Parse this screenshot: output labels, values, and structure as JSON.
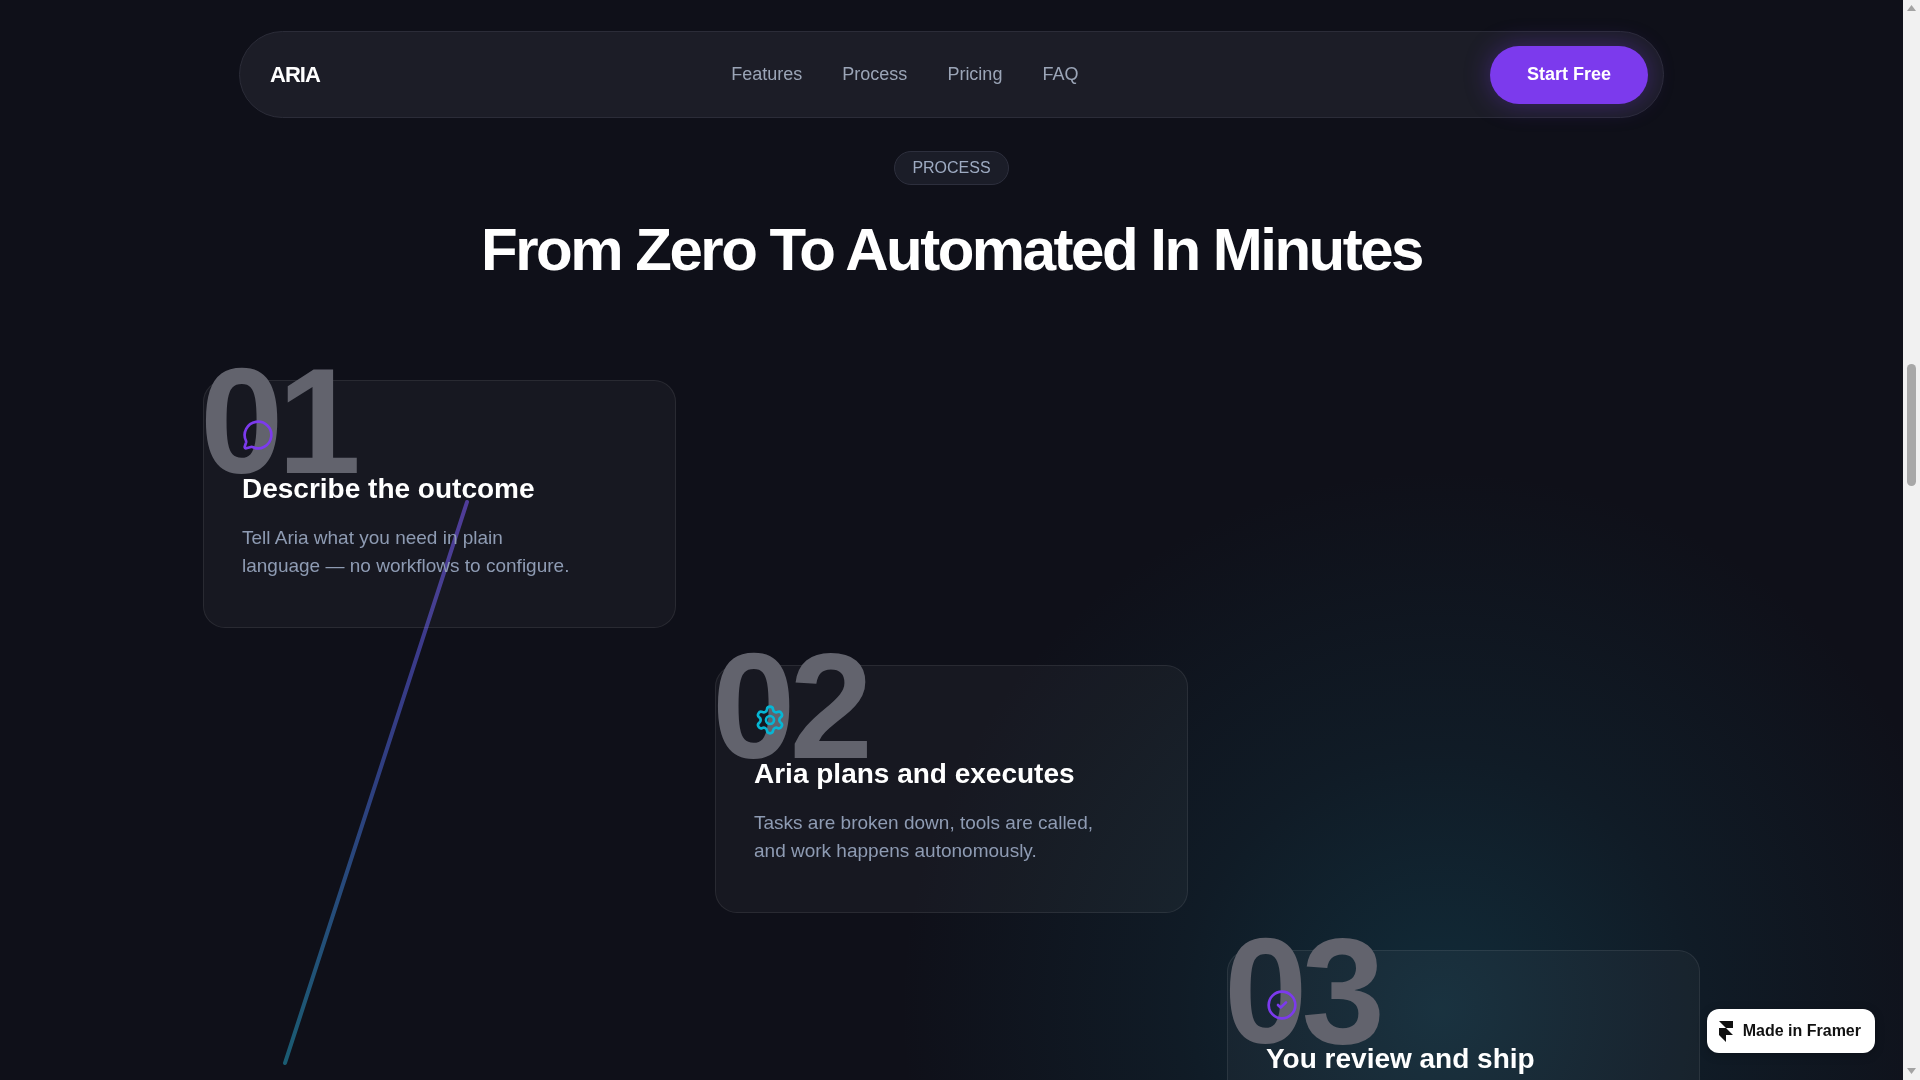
{
  "nav": {
    "logo": "ARIA",
    "links": [
      {
        "label": "Features"
      },
      {
        "label": "Process"
      },
      {
        "label": "Pricing"
      },
      {
        "label": "FAQ"
      }
    ],
    "cta": "Start Free"
  },
  "section": {
    "badge": "PROCESS",
    "title": "From Zero To Automated In Minutes",
    "steps": [
      {
        "number": "01",
        "color": "#7c3aed",
        "title": "Describe the outcome",
        "description": "Tell Aria what you need in plain language — no workflows to configure."
      },
      {
        "number": "02",
        "color": "#06b6d4",
        "title": "Aria plans and executes",
        "description": "Tasks are broken down, tools are called, and work happens autonomously."
      },
      {
        "number": "03",
        "color": "#7c3aed",
        "title": "You review and ship"
      }
    ]
  },
  "framer_badge": {
    "label": "Made in Framer"
  }
}
